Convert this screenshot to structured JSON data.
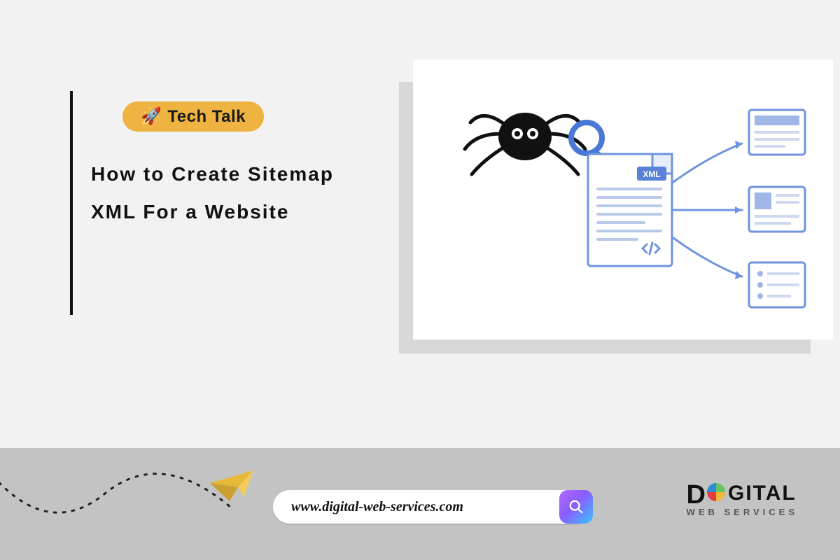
{
  "badge": {
    "icon": "🚀",
    "label": "Tech Talk"
  },
  "headline": {
    "line1": "How to Create Sitemap",
    "line2": "XML For a Website"
  },
  "illustration": {
    "xml_tag": "XML"
  },
  "footer": {
    "url": "www.digital-web-services.com",
    "brand_main_first": "D",
    "brand_main_rest": "GITAL",
    "brand_sub": "WEB SERVICES"
  }
}
